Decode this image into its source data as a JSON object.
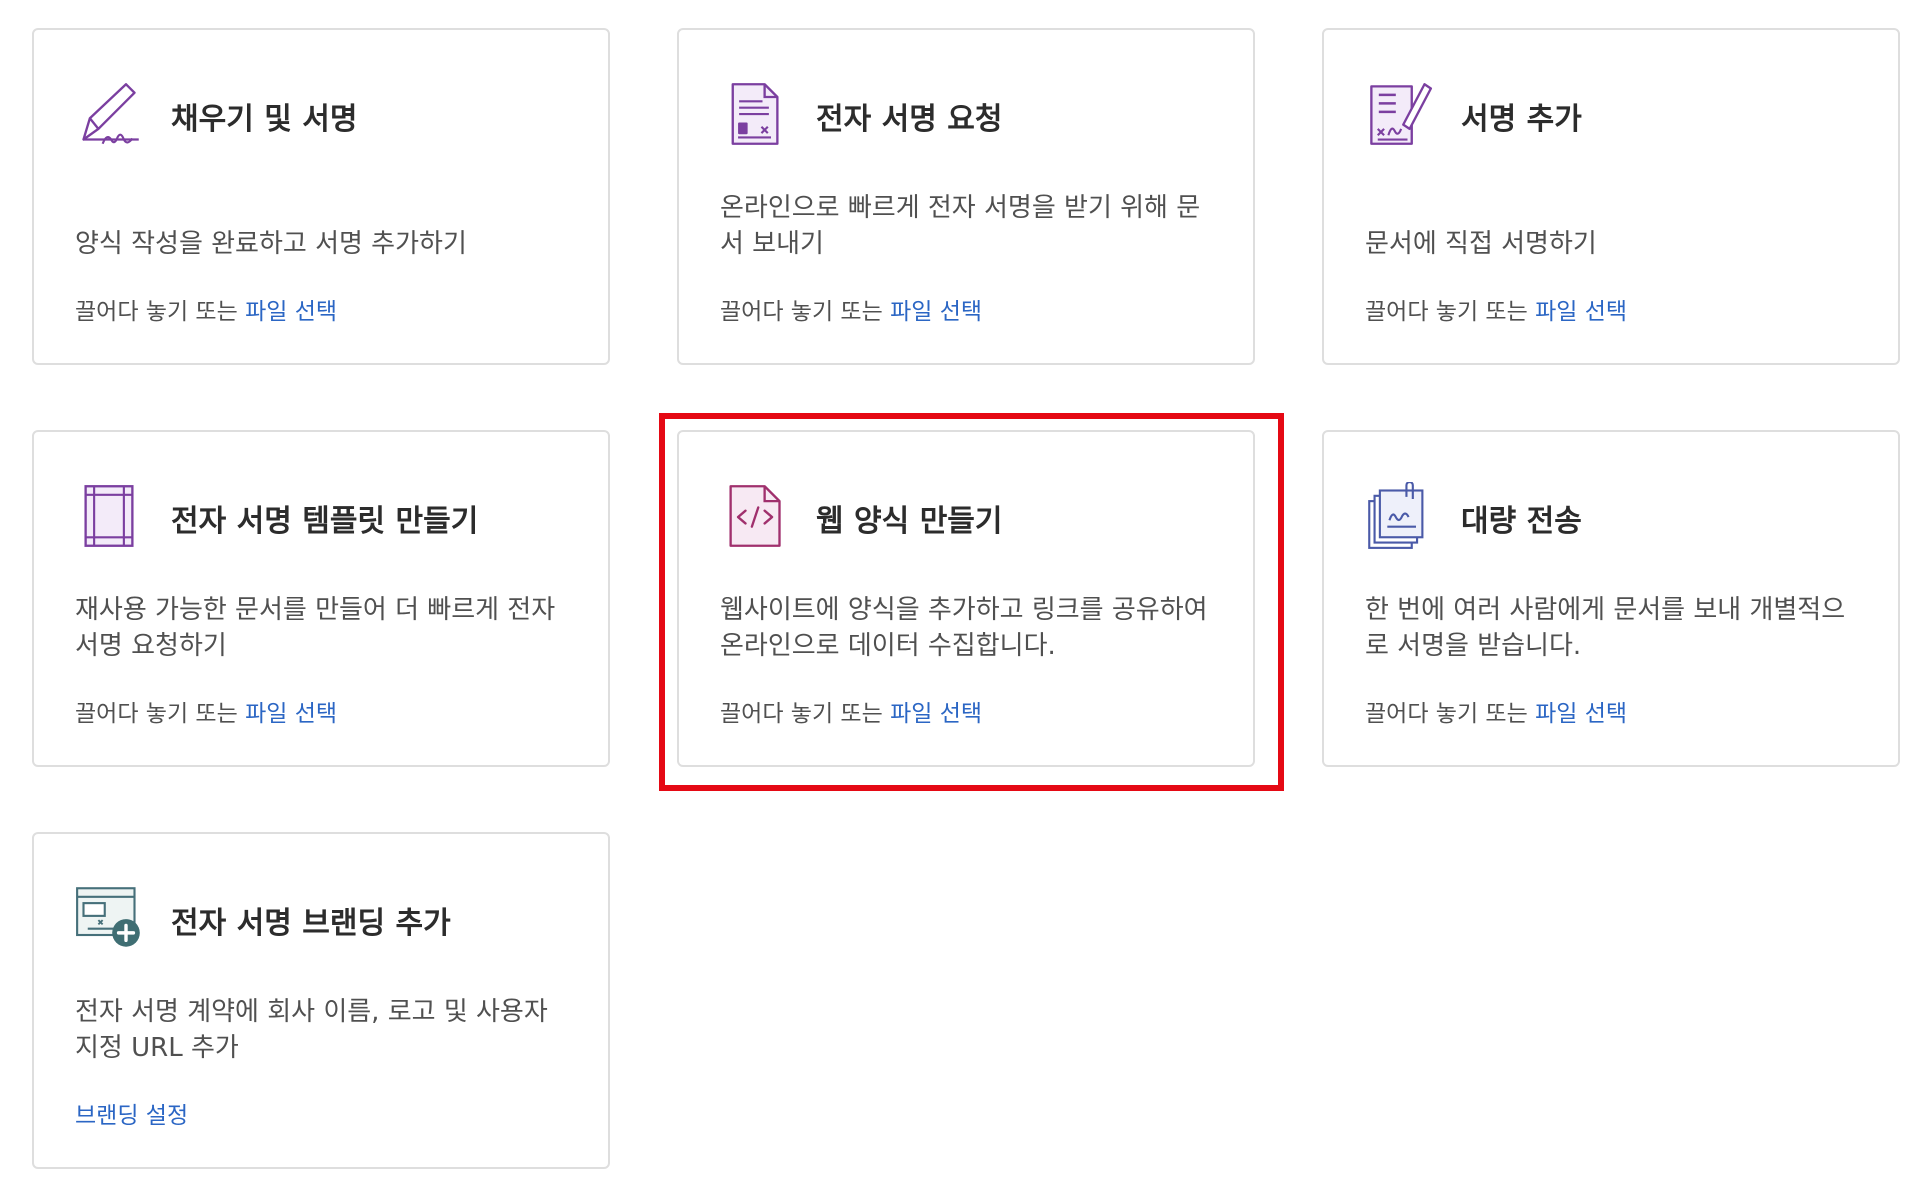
{
  "colors": {
    "accent": "#7b3fa0",
    "link": "#2b66c4",
    "highlight": "#e50914"
  },
  "cards": [
    {
      "icon": "fill-sign-icon",
      "title": "채우기 및 서명",
      "description": "양식 작성을 완료하고 서명 추가하기",
      "action_text": "끌어다 놓기 또는",
      "action_link": "파일 선택"
    },
    {
      "icon": "request-signature-icon",
      "title": "전자 서명 요청",
      "description": "온라인으로 빠르게 전자 서명을 받기 위해 문서 보내기",
      "action_text": "끌어다 놓기 또는",
      "action_link": "파일 선택"
    },
    {
      "icon": "add-signature-icon",
      "title": "서명 추가",
      "description": "문서에 직접 서명하기",
      "action_text": "끌어다 놓기 또는",
      "action_link": "파일 선택"
    },
    {
      "icon": "template-icon",
      "title": "전자 서명 템플릿 만들기",
      "description": "재사용 가능한 문서를 만들어 더 빠르게 전자 서명 요청하기",
      "action_text": "끌어다 놓기 또는",
      "action_link": "파일 선택"
    },
    {
      "icon": "web-form-icon",
      "title": "웹 양식 만들기",
      "description": "웹사이트에 양식을 추가하고 링크를 공유하여 온라인으로 데이터 수집합니다.",
      "action_text": "끌어다 놓기 또는",
      "action_link": "파일 선택",
      "highlighted": true
    },
    {
      "icon": "bulk-send-icon",
      "title": "대량 전송",
      "description": "한 번에 여러 사람에게 문서를 보내 개별적으로 서명을 받습니다.",
      "action_text": "끌어다 놓기 또는",
      "action_link": "파일 선택"
    },
    {
      "icon": "branding-icon",
      "title": "전자 서명 브랜딩 추가",
      "description": "전자 서명 계약에 회사 이름, 로고 및 사용자 지정 URL 추가",
      "action_text": "",
      "action_link": "브랜딩 설정"
    }
  ]
}
